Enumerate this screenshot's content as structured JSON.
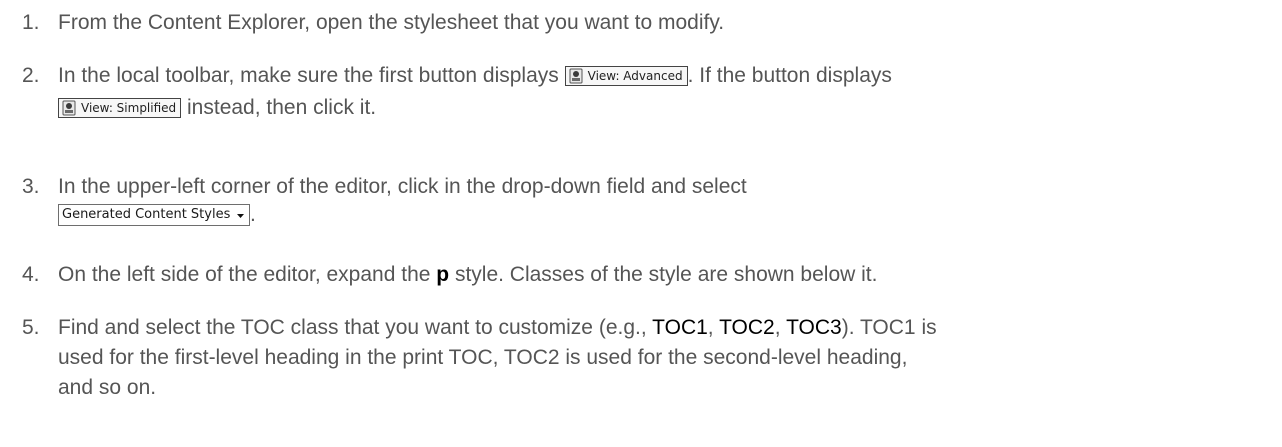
{
  "steps": [
    {
      "number": "1.",
      "text": "From the Content Explorer, open the stylesheet that you want to modify."
    },
    {
      "number": "2.",
      "text_before": "In the local toolbar, make sure the first button displays",
      "button_advanced_label": "View: Advanced",
      "text_middle": ". If the button displays",
      "button_simplified_label": "View: Simplified",
      "text_after": "instead, then click it."
    },
    {
      "number": "3.",
      "text_before": "In the upper-left corner of the editor, click in the drop-down field and select",
      "dropdown_value": "Generated Content Styles",
      "text_after": "."
    },
    {
      "number": "4.",
      "text_before": "On the left side of the editor, expand the",
      "style_name": "p",
      "text_after": "style. Classes of the style are shown below it."
    },
    {
      "number": "5.",
      "line1_before": "Find and select the TOC class that you want to customize (e.g.,",
      "toc1": "TOC1",
      "sep1": ",",
      "toc2": "TOC2",
      "sep2": ",",
      "toc3": "TOC3",
      "line1_after": "). TOC1 is",
      "line2": "used for the first-level heading in the print TOC, TOC2 is used for the second-level heading,",
      "line3": "and so on."
    }
  ],
  "icons": {
    "view_button_icon": "speaker-eye-icon",
    "dropdown_caret_icon": "caret-down-icon"
  }
}
